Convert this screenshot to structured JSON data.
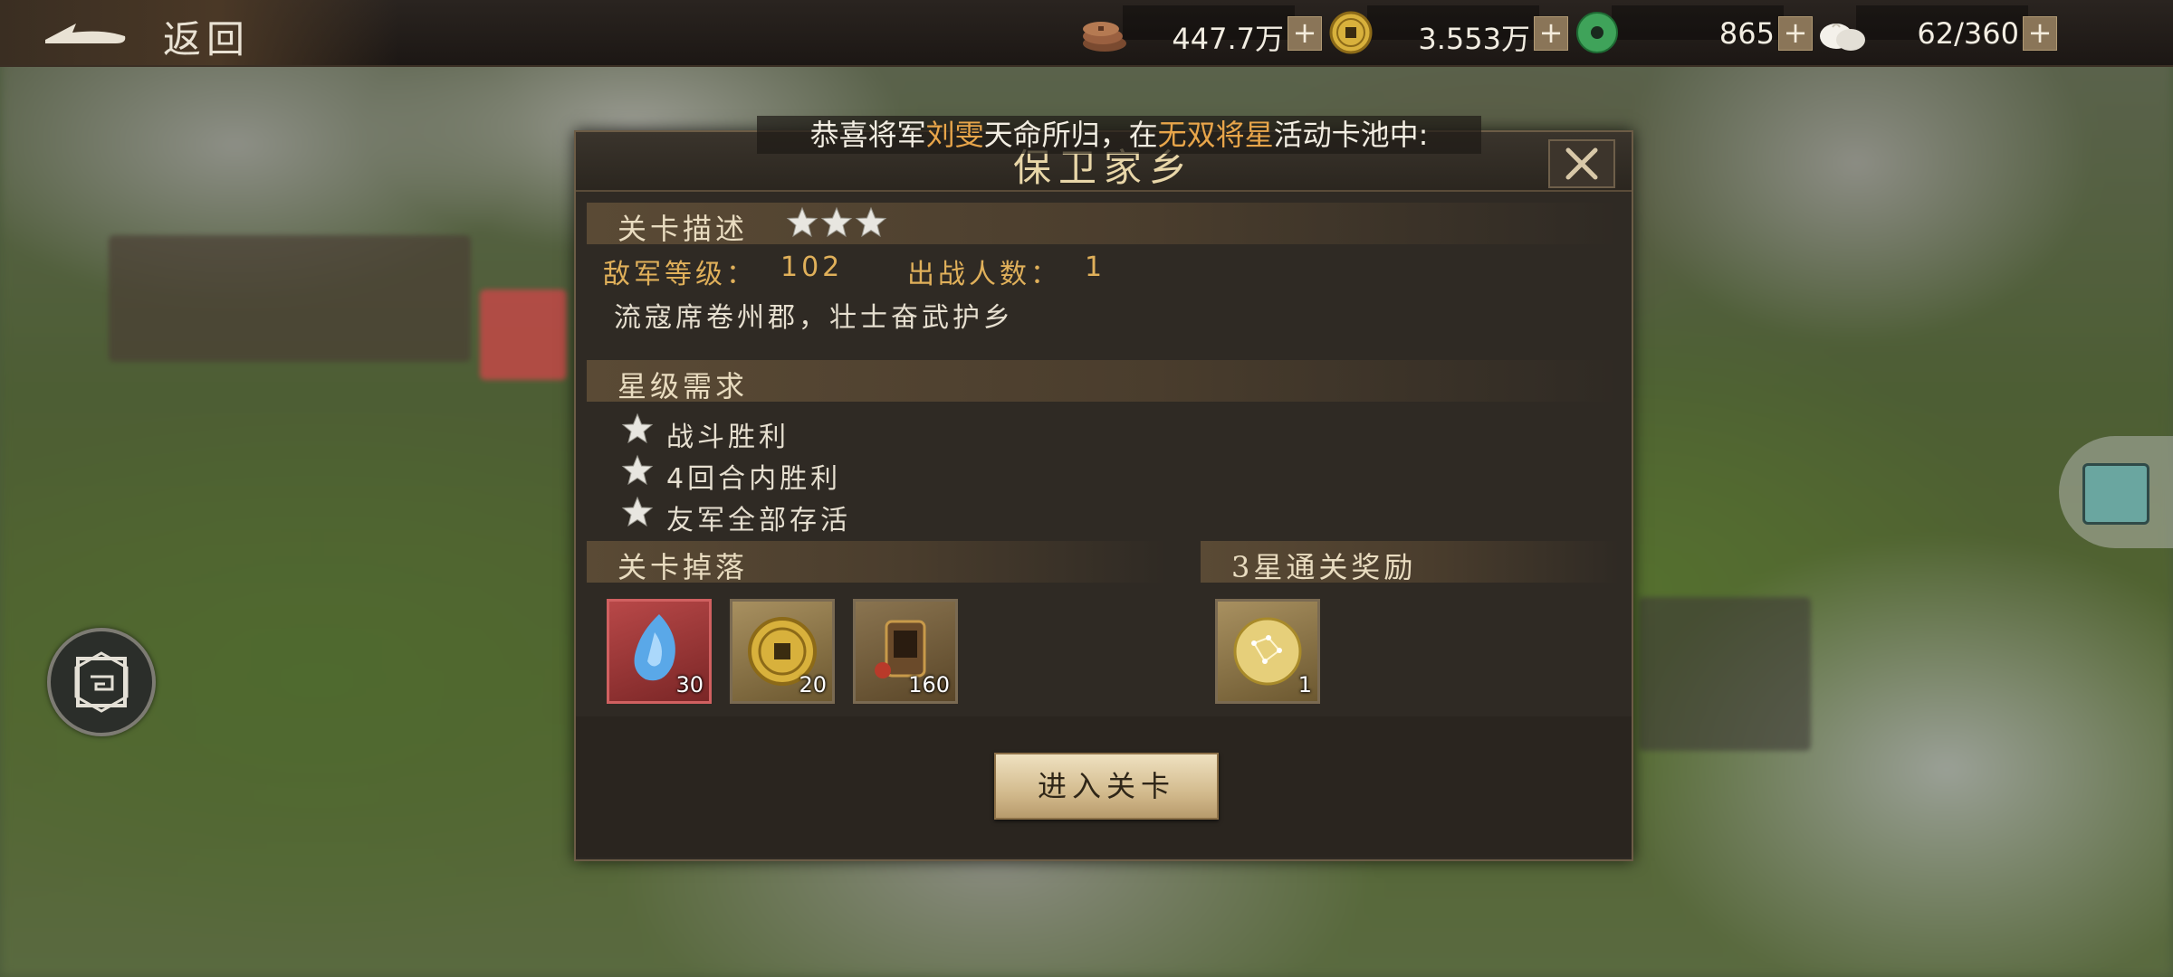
{
  "topbar": {
    "back_label": "返回",
    "resources": [
      {
        "icon": "copper-coins-icon",
        "value": "447.7万"
      },
      {
        "icon": "gold-coin-icon",
        "value": "3.553万"
      },
      {
        "icon": "jade-disc-icon",
        "value": "865"
      },
      {
        "icon": "stamina-bun-icon",
        "value": "62/360"
      }
    ],
    "plus_label": "+"
  },
  "banner": {
    "prefix": "恭喜将军",
    "name": "刘雯",
    "middle": "天命所归，在",
    "pool": "无双将星",
    "suffix": "活动卡池中:"
  },
  "dialog": {
    "title": "保卫家乡",
    "description_label": "关卡描述",
    "difficulty_stars": 3,
    "enemy_level_label": "敌军等级：",
    "enemy_level_value": "102",
    "team_size_label": "出战人数：",
    "team_size_value": "1",
    "description": "流寇席卷州郡，壮士奋武护乡",
    "star_req_label": "星级需求",
    "requirements": [
      "战斗胜利",
      "4回合内胜利",
      "友军全部存活"
    ],
    "drops_label": "关卡掉落",
    "drops": [
      {
        "icon": "blue-soul-gem-icon",
        "count": "30"
      },
      {
        "icon": "gold-coin-icon",
        "count": "20"
      },
      {
        "icon": "gear-pack-icon",
        "count": "160"
      }
    ],
    "three_star_label": "3星通关奖励",
    "three_star_rewards": [
      {
        "icon": "star-chart-orb-icon",
        "count": "1"
      }
    ],
    "enter_label": "进入关卡"
  },
  "colors": {
    "highlight": "#e8a54a",
    "gold_text": "#e0b05a",
    "panel": "#2f2a24"
  }
}
